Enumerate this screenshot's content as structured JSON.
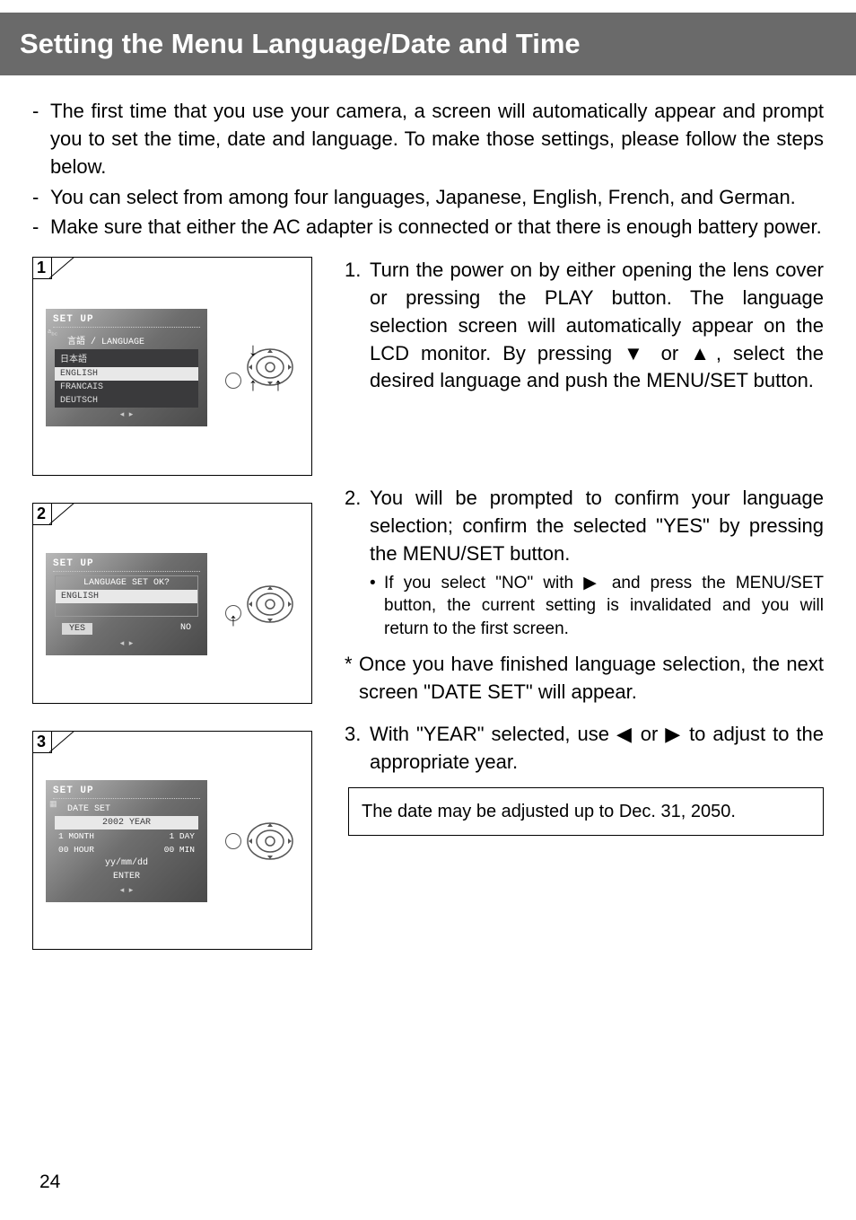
{
  "header": {
    "title": "Setting the Menu Language/Date and Time"
  },
  "intro": [
    "The first time that you use your camera, a screen will automatically appear and prompt you to set the time, date and language. To make those settings, please follow the steps below.",
    "You can select from among four languages, Japanese, English, French, and German.",
    "Make sure that either the AC adapter is connected or that there is enough battery power."
  ],
  "figures": {
    "f1": {
      "num": "1",
      "lcd_title": "SET UP",
      "lang_header": "言語 / LANGUAGE",
      "opts": [
        "日本語",
        "ENGLISH",
        "FRANCAIS",
        "DEUTSCH"
      ]
    },
    "f2": {
      "num": "2",
      "lcd_title": "SET UP",
      "prompt": "LANGUAGE SET OK?",
      "value": "ENGLISH",
      "yes": "YES",
      "no": "NO"
    },
    "f3": {
      "num": "3",
      "lcd_title": "SET UP",
      "section": "DATE SET",
      "year": "2002 YEAR",
      "month": "1 MONTH",
      "day": "1 DAY",
      "hour": "00 HOUR",
      "min": "00 MIN",
      "fmt": "yy/mm/dd",
      "enter": "ENTER"
    }
  },
  "steps": {
    "s1": {
      "num": "1.",
      "text": "Turn the power on by either opening the lens cover or pressing the PLAY button. The language selection screen will automatically appear on the LCD monitor. By pressing ▼ or ▲, select the desired language and push the MENU/SET button."
    },
    "s2": {
      "num": "2.",
      "text": "You will be prompted to confirm your language selection; confirm the selected \"YES\" by pressing the MENU/SET button.",
      "bullet": "If you select \"NO\" with ▶ and press the MENU/SET button, the current setting is invalidated and you will return to the first screen."
    },
    "note": "Once you have finished language selection, the next screen \"DATE SET\" will appear.",
    "s3": {
      "num": "3.",
      "text": "With \"YEAR\" selected, use ◀ or ▶ to adjust to the appropriate year."
    },
    "info": "The date may be adjusted up to Dec. 31, 2050."
  },
  "page": "24"
}
